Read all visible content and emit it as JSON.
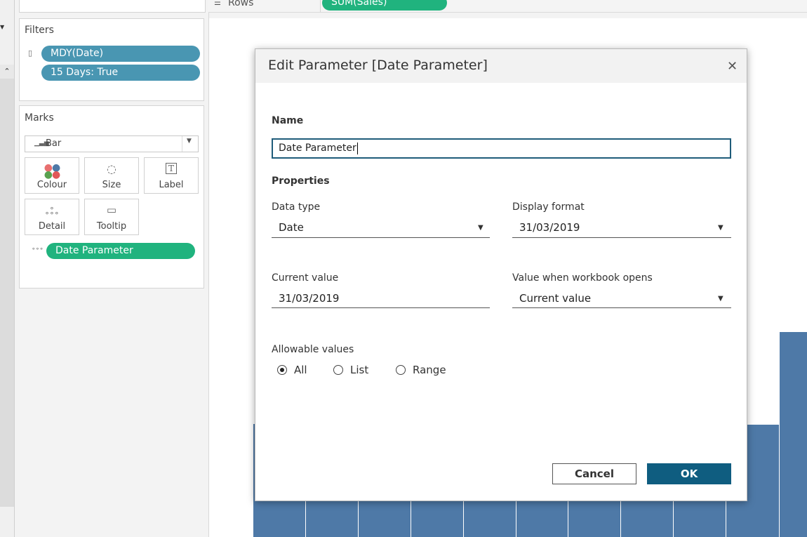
{
  "shelves": {
    "rows_label": "Rows",
    "rows_pill": "SUM(Sales)"
  },
  "filters": {
    "title": "Filters",
    "pills": [
      "MDY(Date)",
      "15 Days: True"
    ]
  },
  "marks": {
    "title": "Marks",
    "mark_type": "Bar",
    "buttons": [
      "Colour",
      "Size",
      "Label",
      "Detail",
      "Tooltip"
    ],
    "detail_pill": "Date Parameter"
  },
  "dialog": {
    "title": "Edit Parameter [Date Parameter]",
    "name_label": "Name",
    "name_value": "Date Parameter",
    "properties_label": "Properties",
    "data_type_label": "Data type",
    "data_type_value": "Date",
    "display_format_label": "Display format",
    "display_format_value": "31/03/2019",
    "current_value_label": "Current value",
    "current_value_value": "31/03/2019",
    "workbook_opens_label": "Value when workbook opens",
    "workbook_opens_value": "Current value",
    "allowable_label": "Allowable values",
    "allowable_options": [
      "All",
      "List",
      "Range"
    ],
    "allowable_selected": "All",
    "cancel_label": "Cancel",
    "ok_label": "OK"
  },
  "colors": {
    "bar": "#4e79a7",
    "pill_blue": "#4996b2",
    "pill_green": "#20b37e",
    "ok_button": "#0f5d80"
  },
  "icons": [
    "chevron-down-icon",
    "chevron-up-icon",
    "rows-icon",
    "filter-icon",
    "bar-mark-icon",
    "colour-icon",
    "size-icon",
    "label-icon",
    "detail-icon",
    "tooltip-icon",
    "close-icon"
  ]
}
